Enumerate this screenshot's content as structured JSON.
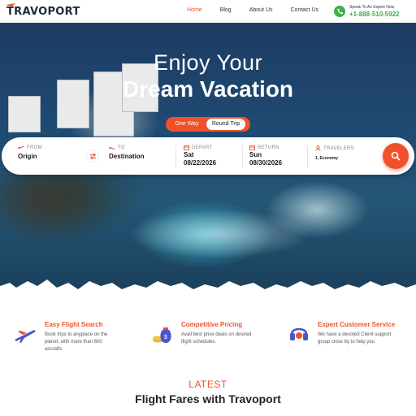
{
  "brand": {
    "logo": "TRAVOPORT"
  },
  "nav": {
    "items": [
      "Home",
      "Blog",
      "About Us",
      "Contact Us"
    ],
    "active": "Home"
  },
  "contact": {
    "label": "Speak To An Expert Now",
    "phone": "+1-888-510-5922"
  },
  "hero": {
    "line1": "Enjoy Your",
    "line2": "Dream Vacation",
    "trip_types": [
      "One Way",
      "Round Trip"
    ],
    "selected_trip": "Round Trip"
  },
  "search": {
    "from": {
      "label": "FROM",
      "value": "Origin"
    },
    "to": {
      "label": "TO",
      "value": "Destination"
    },
    "depart": {
      "label": "DEPART",
      "day": "Sat",
      "date": "08/22/2026"
    },
    "return": {
      "label": "RETURN",
      "day": "Sun",
      "date": "08/30/2026"
    },
    "travelers": {
      "label": "TRAVELERS",
      "value": "1, Economy"
    }
  },
  "features": [
    {
      "icon": "plane-icon",
      "title": "Easy Flight Search",
      "desc": [
        "Book trips to anyplace on the",
        "planet, with more than 600",
        "aircrafts"
      ]
    },
    {
      "icon": "money-bag-icon",
      "title": "Competitive Pricing",
      "desc": [
        "Avail best price deals on desired",
        "flight schedules."
      ]
    },
    {
      "icon": "headset-icon",
      "title": "Expert Customer Service",
      "desc": [
        "We have a devoted Client support",
        "group close by to help you"
      ]
    }
  ],
  "section": {
    "eyebrow": "LATEST",
    "title": "Flight Fares with Travoport"
  },
  "colors": {
    "accent": "#f0512b",
    "green": "#3fb047"
  }
}
